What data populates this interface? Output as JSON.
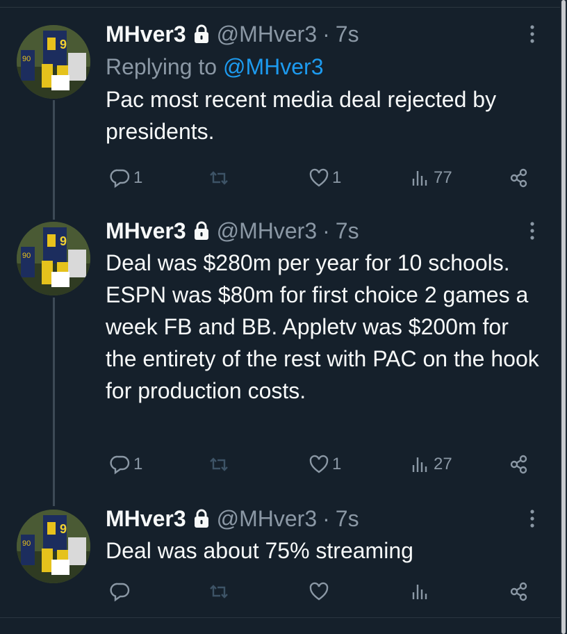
{
  "tweets": [
    {
      "name": "MHver3",
      "handle": "@MHver3",
      "separator": "·",
      "time": "7s",
      "replying_prefix": "Replying to",
      "replying_handle": "@MHver3",
      "text": "Pac most recent media deal rejected by presidents.",
      "reply_count": "1",
      "retweet_count": "",
      "like_count": "1",
      "view_count": "77"
    },
    {
      "name": "MHver3",
      "handle": "@MHver3",
      "separator": "·",
      "time": "7s",
      "text": "Deal was $280m per year for 10 schools. ESPN was $80m for first choice 2 games a week FB and BB. Appletv was $200m for the entirety of the rest with PAC on the hook for production costs.",
      "reply_count": "1",
      "retweet_count": "",
      "like_count": "1",
      "view_count": "27"
    },
    {
      "name": "MHver3",
      "handle": "@MHver3",
      "separator": "·",
      "time": "7s",
      "text": "Deal was about 75% streaming",
      "reply_count": "",
      "retweet_count": "",
      "like_count": "",
      "view_count": ""
    }
  ],
  "icons": {
    "reply": "reply-icon",
    "retweet": "retweet-icon",
    "like": "heart-icon",
    "views": "views-icon",
    "share": "share-icon",
    "lock": "lock-icon",
    "more": "more-icon"
  },
  "colors": {
    "background": "#15202b",
    "text": "#f7f9f9",
    "muted": "#8b98a5",
    "link": "#1d9bf0"
  }
}
